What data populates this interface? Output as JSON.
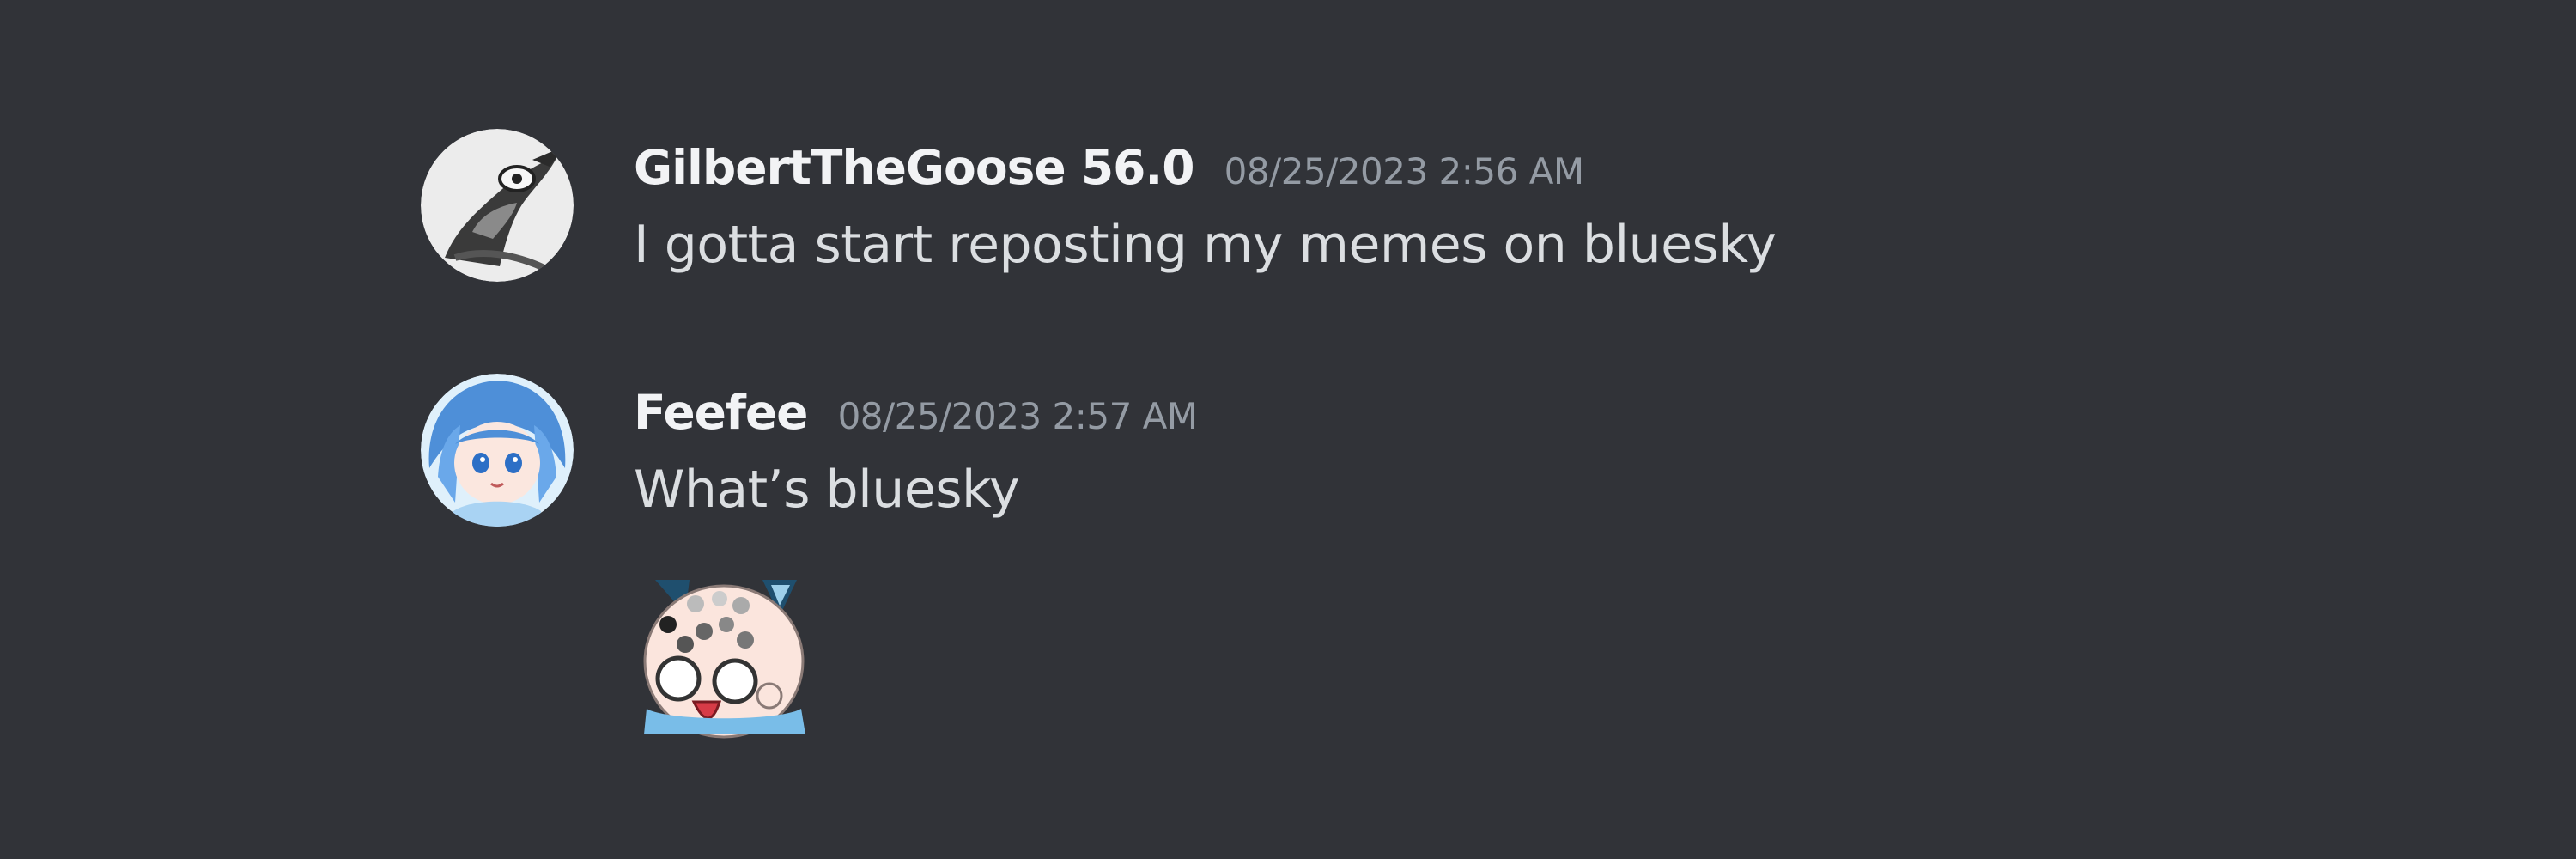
{
  "messages": [
    {
      "author": "GilbertTheGoose 56.0",
      "timestamp": "08/25/2023 2:56 AM",
      "text": "I gotta start reposting my memes on bluesky",
      "avatar": "goose-avatar"
    },
    {
      "author": "Feefee",
      "timestamp": "08/25/2023 2:57 AM",
      "text": "What’s bluesky",
      "avatar": "anime-girl-avatar",
      "sticker": "surprised-chibi-emoji"
    }
  ],
  "colors": {
    "background": "#313338",
    "username": "#f2f3f5",
    "timestamp": "#949ba4",
    "message_text": "#dbdee1"
  }
}
